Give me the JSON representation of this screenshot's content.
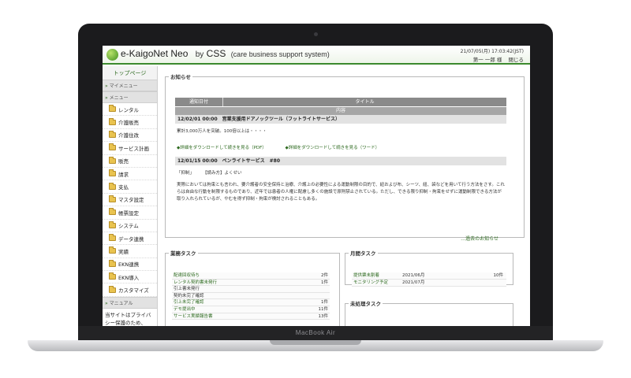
{
  "device": {
    "brand": "MacBook Air"
  },
  "header": {
    "logo_main": "e-KaigoNet",
    "logo_neo": "Neo",
    "logo_by": "by",
    "logo_css": "CSS",
    "logo_full": "(care business support system)",
    "datetime": "21/07/05(月) 17:03:42(JST)",
    "user_name": "第一 一郎 様",
    "logout_label": "閉じる"
  },
  "sidebar": {
    "top_label": "トップページ",
    "sections": {
      "mypage": "マイメニュー",
      "menu": "メニュー",
      "manual": "マニュアル"
    },
    "items": [
      {
        "label": "レンタル"
      },
      {
        "label": "介護販売"
      },
      {
        "label": "介護住改"
      },
      {
        "label": "サービス計画"
      },
      {
        "label": "販売"
      },
      {
        "label": "請求"
      },
      {
        "label": "支払"
      },
      {
        "label": "マスタ設定"
      },
      {
        "label": "帳票設定"
      },
      {
        "label": "システム"
      },
      {
        "label": "データ連携"
      },
      {
        "label": "実績"
      },
      {
        "label": "EKN連携"
      },
      {
        "label": "EKN導入"
      },
      {
        "label": "カスタマイズ"
      }
    ],
    "notice": "当サイトはプライバシー保護のため、SSL暗号化"
  },
  "news": {
    "legend": "お知らせ",
    "col_date": "通知日付",
    "col_title": "タイトル",
    "col_content": "内容",
    "items": [
      {
        "head": "12/02/01 00:00　営業支援用ドアノックツール（フットライトサービス）",
        "body": "累計3,000万人を突破。100倍以上は・・・・",
        "link1": "◆詳細をダウンロードして続きを見る（PDF）",
        "link2": "◆詳細をダウンロードして続きを見る（ワード）"
      },
      {
        "head": "12/01/15 00:00　ペンライトサービス　#80",
        "body1": "「抑制」　　　【読み方】よくせい",
        "body2": "実際においては拘束とも言われ、要介護者の安全保持と治療、介護上の必要性による運動制限の目的で、紐および布、シーツ、紐、袋などを用いて行う方法をさす。これらは自由な行動を制限するものであり、近年では患者の人権に配慮し多くの施設で原則禁止されている。ただし、できる限り抑制・拘束をせずに運動制限できる方法が取り入れられているが、やむを得ず抑制・拘束が検討されることもある。"
      }
    ],
    "past_link": "…過去のお知らせ"
  },
  "tasks": {
    "legend": "業務タスク",
    "rows": [
      {
        "label": "配達回収待ち",
        "count": "2件"
      },
      {
        "label": "レンタル契約書未発行",
        "count": "1件"
      },
      {
        "label": "引上書未発行",
        "count": ""
      },
      {
        "label": "契約未完了確認",
        "count": ""
      },
      {
        "label": "引上未完了確認",
        "count": "1件"
      },
      {
        "label": "デモ提出中",
        "count": "11件"
      },
      {
        "label": "サービス実績報告書",
        "count": "13件"
      }
    ]
  },
  "monthly": {
    "legend": "月間タスク",
    "rows": [
      {
        "label": "提供票未割着",
        "date": "2021/06月",
        "count": "10件"
      },
      {
        "label": "モニタリング予定",
        "date": "2021/07月",
        "count": ""
      }
    ]
  },
  "pending": {
    "legend": "未処理タスク"
  }
}
